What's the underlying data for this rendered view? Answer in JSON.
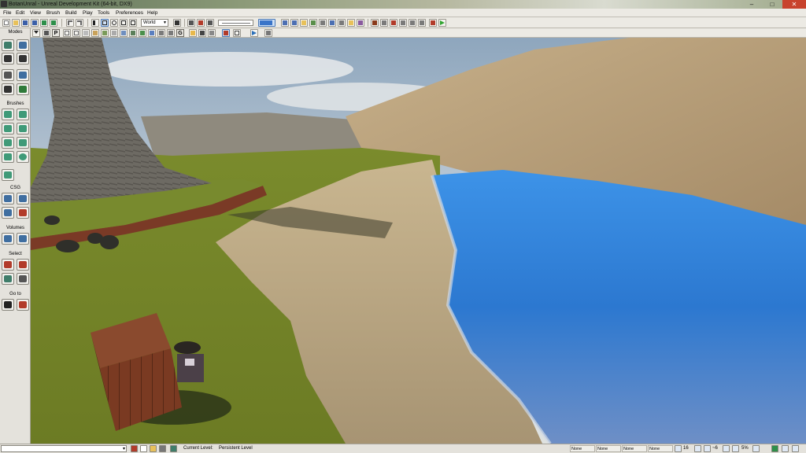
{
  "window": {
    "title": "BotanUnral - Unreal Development Kit (64-bit, DX9)",
    "minimize": "–",
    "maximize": "□",
    "close": "✕"
  },
  "menu": [
    "File",
    "Edit",
    "View",
    "Brush",
    "Build",
    "Play",
    "Tools",
    "Preferences",
    "Help"
  ],
  "toolbar": {
    "coordinate_system": "World",
    "coordinate_arrow": "▼",
    "letter_buttons": [
      "P",
      "G"
    ]
  },
  "modes_panel": {
    "header": "Modes",
    "sections": {
      "brushes": "Brushes",
      "csg": "CSG",
      "volumes": "Volumes",
      "select": "Select",
      "go_to": "Go to"
    }
  },
  "statusbar": {
    "level_label": "Current Level:",
    "level_value": "Persistent Level",
    "cells": [
      "None",
      "None",
      "None",
      "None"
    ],
    "grid_size": "16",
    "rotation_snap": "~6",
    "scale_snap": "5%"
  },
  "colors": {
    "accent": "#4a78b5",
    "water": "#2f7fd6",
    "grass": "#7b8a2a",
    "rock": "#b9a27d",
    "sky": "#a9bccf",
    "play_green": "#2fa32f",
    "close_red": "#c8432d"
  },
  "icons": {
    "viewport_play": "play-icon",
    "open": "open-folder-icon",
    "save": "save-icon"
  }
}
